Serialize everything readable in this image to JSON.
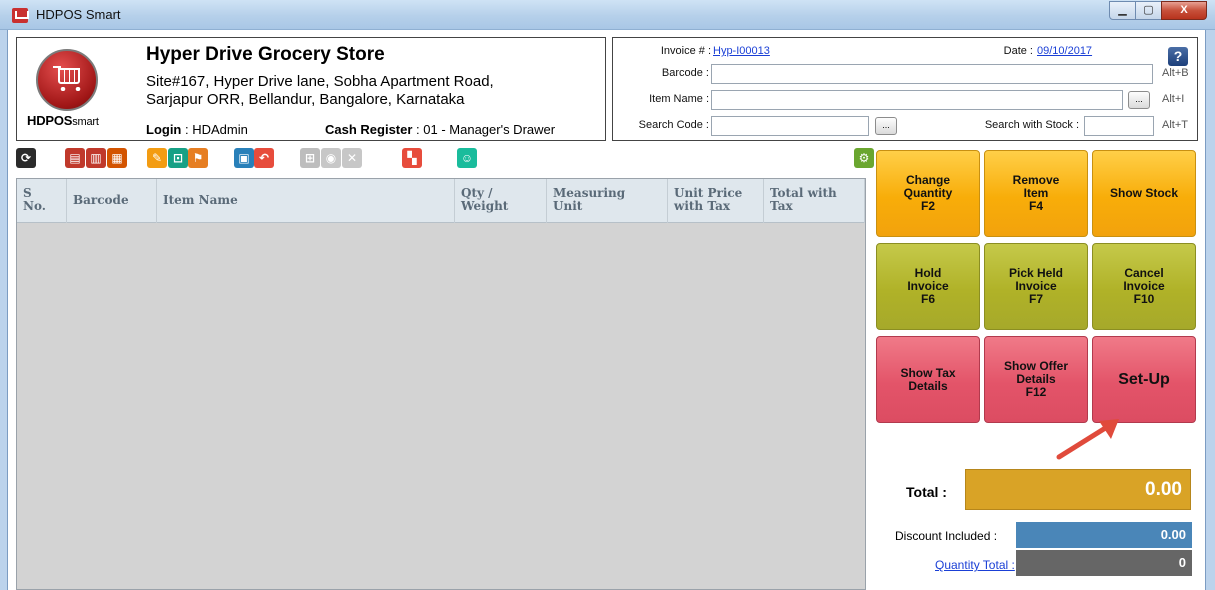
{
  "window": {
    "title": "HDPOS Smart",
    "minimize_label": "▭",
    "maximize_label": "▣",
    "close_label": "X"
  },
  "store": {
    "name": "Hyper Drive Grocery Store",
    "address_line1": "Site#167, Hyper Drive lane, Sobha Apartment Road,",
    "address_line2": "Sarjapur ORR, Bellandur, Bangalore, Karnataka",
    "login_label": "Login",
    "login_value": ": HDAdmin",
    "cash_label": "Cash Register",
    "cash_value": ": 01 - Manager's Drawer",
    "logo_text": "HDPOS",
    "logo_subtext": "smart"
  },
  "invoice": {
    "invoice_label": "Invoice # :",
    "invoice_value": "Hyp-I00013",
    "date_label": "Date :",
    "date_value": "09/10/2017",
    "barcode_label": "Barcode :",
    "barcode_value": "",
    "barcode_hint": "Alt+B",
    "item_name_label": "Item Name :",
    "item_name_value": "",
    "item_name_hint": "Alt+I",
    "search_code_label": "Search Code :",
    "search_code_value": "",
    "search_stock_label": "Search with Stock :",
    "search_stock_value": "",
    "search_hint": "Alt+T",
    "dots_label": "...",
    "help_label": "?"
  },
  "toolbar": {
    "icons": [
      {
        "name": "refresh-icon",
        "color": "#2b2b2b",
        "glyph": "⟳"
      },
      {
        "name": "report-icon",
        "color": "#c0392b",
        "glyph": "▤"
      },
      {
        "name": "copy-report-icon",
        "color": "#c0392b",
        "glyph": "▥"
      },
      {
        "name": "export-report-icon",
        "color": "#d35400",
        "glyph": "▦"
      },
      {
        "name": "edit-list-icon",
        "color": "#f39c12",
        "glyph": "✎"
      },
      {
        "name": "cart-icon",
        "color": "#16a085",
        "glyph": "⊡"
      },
      {
        "name": "delivery-icon",
        "color": "#e67e22",
        "glyph": "⚑"
      },
      {
        "name": "payment-icon",
        "color": "#2980b9",
        "glyph": "▣"
      },
      {
        "name": "return-icon",
        "color": "#e74c3c",
        "glyph": "↶"
      },
      {
        "name": "calculator-icon",
        "color": "#bdbdbd",
        "glyph": "⊞"
      },
      {
        "name": "coupon-icon",
        "color": "#c7c7c7",
        "glyph": "◉"
      },
      {
        "name": "void-icon",
        "color": "#c7c7c7",
        "glyph": "✕"
      },
      {
        "name": "apps-icon",
        "color": "#e74c3c",
        "glyph": "▚"
      },
      {
        "name": "customer-icon",
        "color": "#1abc9c",
        "glyph": "☺"
      },
      {
        "name": "settings-gear-icon",
        "color": "#6aa62f",
        "glyph": "⚙"
      }
    ]
  },
  "grid": {
    "columns": [
      {
        "line1": "S",
        "line2": "No."
      },
      {
        "line1": "Barcode",
        "line2": ""
      },
      {
        "line1": "Item Name",
        "line2": ""
      },
      {
        "line1": "Qty /",
        "line2": "Weight"
      },
      {
        "line1": "Measuring",
        "line2": "Unit"
      },
      {
        "line1": "Unit Price",
        "line2": "with Tax"
      },
      {
        "line1": "Total with",
        "line2": "Tax"
      }
    ],
    "rows": []
  },
  "actions": {
    "change_quantity": {
      "line1": "Change",
      "line2": "Quantity",
      "line3": "F2"
    },
    "remove_item": {
      "line1": "Remove",
      "line2": "Item",
      "line3": "F4"
    },
    "show_stock": {
      "line1": "Show Stock"
    },
    "hold_invoice": {
      "line1": "Hold",
      "line2": "Invoice",
      "line3": "F6"
    },
    "pick_held_invoice": {
      "line1": "Pick Held",
      "line2": "Invoice",
      "line3": "F7"
    },
    "cancel_invoice": {
      "line1": "Cancel",
      "line2": "Invoice",
      "line3": "F10"
    },
    "show_tax": {
      "line1": "Show Tax",
      "line2": "Details"
    },
    "show_offer": {
      "line1": "Show Offer",
      "line2": "Details",
      "line3": "F12"
    },
    "setup": {
      "line1": "Set-Up"
    }
  },
  "totals": {
    "total_label": "Total :",
    "total_value": "0.00",
    "discount_label": "Discount Included :",
    "discount_value": "0.00",
    "quantity_label": "Quantity Total :",
    "quantity_value": "0"
  },
  "colors": {
    "orange": "#f8ad09",
    "olive": "#b0b228",
    "pink": "#e35469",
    "total": "#d9a326",
    "discount": "#4a86b8",
    "quantity": "#666666",
    "arrow": "#e04a3b"
  }
}
